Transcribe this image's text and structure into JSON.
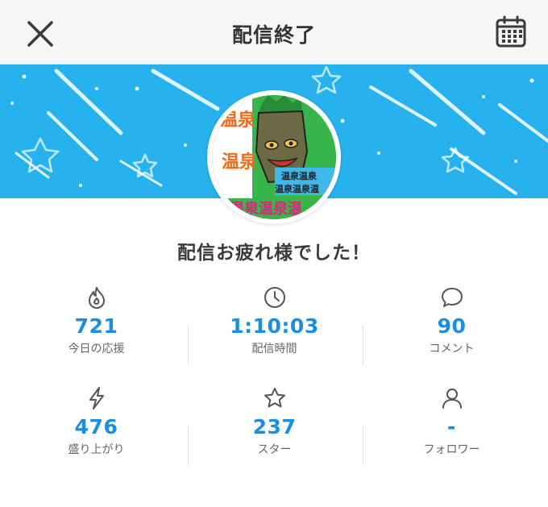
{
  "header": {
    "title": "配信終了"
  },
  "avatar": {
    "overlay_text_1": "温泉",
    "overlay_text_2": "温泉",
    "overlay_text_3": "温泉温泉",
    "overlay_text_4": "温泉温泉温",
    "overlay_text_5": "温泉温泉温"
  },
  "message": "配信お疲れ様でした！",
  "stats": [
    {
      "value": "721",
      "label": "今日の応援",
      "icon": "flame-icon"
    },
    {
      "value": "1:10:03",
      "label": "配信時間",
      "icon": "clock-icon"
    },
    {
      "value": "90",
      "label": "コメント",
      "icon": "speech-bubble-icon"
    },
    {
      "value": "476",
      "label": "盛り上がり",
      "icon": "lightning-icon"
    },
    {
      "value": "237",
      "label": "スター",
      "icon": "star-icon"
    },
    {
      "value": "-",
      "label": "フォロワー",
      "icon": "person-icon"
    }
  ],
  "colors": {
    "banner": "#27b2ee",
    "value_text": "#1a8ee2",
    "label_text": "#666666"
  }
}
